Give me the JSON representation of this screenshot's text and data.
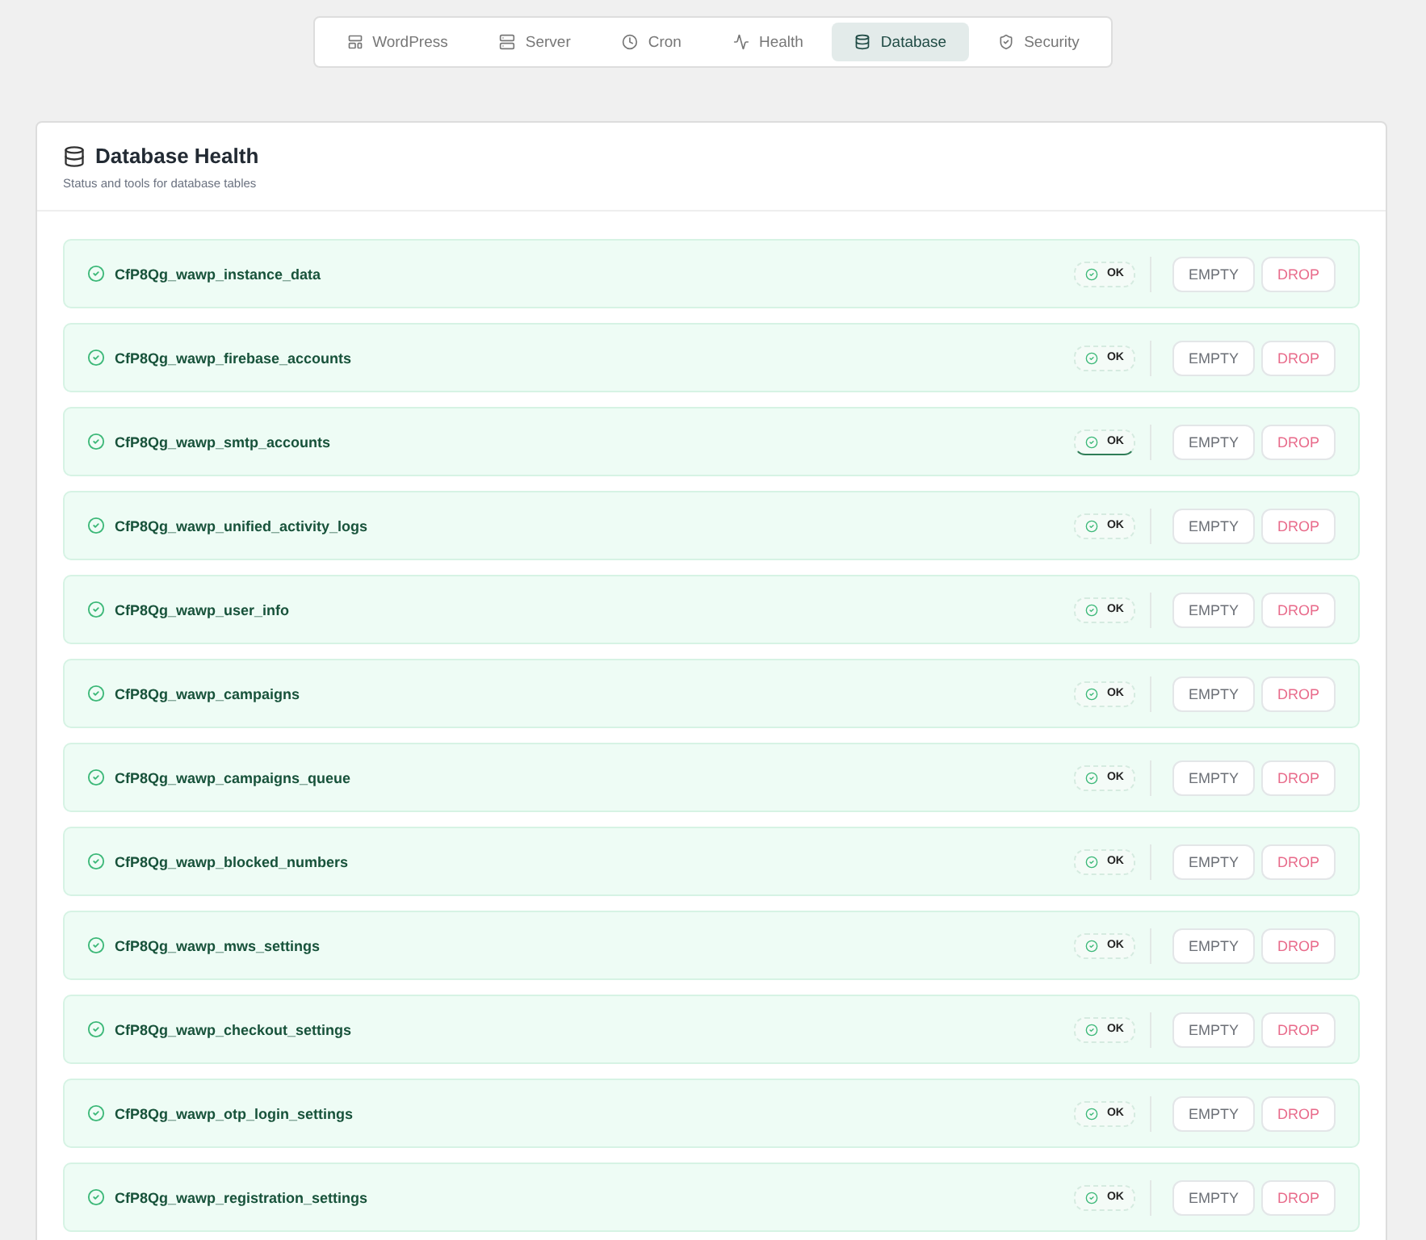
{
  "tabs": [
    {
      "label": "WordPress",
      "selected": false
    },
    {
      "label": "Server",
      "selected": false
    },
    {
      "label": "Cron",
      "selected": false
    },
    {
      "label": "Health",
      "selected": false
    },
    {
      "label": "Database",
      "selected": true
    },
    {
      "label": "Security",
      "selected": false
    }
  ],
  "panel": {
    "title": "Database Health",
    "subtitle": "Status and tools for database tables"
  },
  "tables": [
    {
      "name": "CfP8Qg_wawp_instance_data",
      "status": "OK",
      "focused": false,
      "empty": "EMPTY",
      "drop": "DROP"
    },
    {
      "name": "CfP8Qg_wawp_firebase_accounts",
      "status": "OK",
      "focused": false,
      "empty": "EMPTY",
      "drop": "DROP"
    },
    {
      "name": "CfP8Qg_wawp_smtp_accounts",
      "status": "OK",
      "focused": true,
      "empty": "EMPTY",
      "drop": "DROP"
    },
    {
      "name": "CfP8Qg_wawp_unified_activity_logs",
      "status": "OK",
      "focused": false,
      "empty": "EMPTY",
      "drop": "DROP"
    },
    {
      "name": "CfP8Qg_wawp_user_info",
      "status": "OK",
      "focused": false,
      "empty": "EMPTY",
      "drop": "DROP"
    },
    {
      "name": "CfP8Qg_wawp_campaigns",
      "status": "OK",
      "focused": false,
      "empty": "EMPTY",
      "drop": "DROP"
    },
    {
      "name": "CfP8Qg_wawp_campaigns_queue",
      "status": "OK",
      "focused": false,
      "empty": "EMPTY",
      "drop": "DROP"
    },
    {
      "name": "CfP8Qg_wawp_blocked_numbers",
      "status": "OK",
      "focused": false,
      "empty": "EMPTY",
      "drop": "DROP"
    },
    {
      "name": "CfP8Qg_wawp_mws_settings",
      "status": "OK",
      "focused": false,
      "empty": "EMPTY",
      "drop": "DROP"
    },
    {
      "name": "CfP8Qg_wawp_checkout_settings",
      "status": "OK",
      "focused": false,
      "empty": "EMPTY",
      "drop": "DROP"
    },
    {
      "name": "CfP8Qg_wawp_otp_login_settings",
      "status": "OK",
      "focused": false,
      "empty": "EMPTY",
      "drop": "DROP"
    },
    {
      "name": "CfP8Qg_wawp_registration_settings",
      "status": "OK",
      "focused": false,
      "empty": "EMPTY",
      "drop": "DROP"
    }
  ]
}
